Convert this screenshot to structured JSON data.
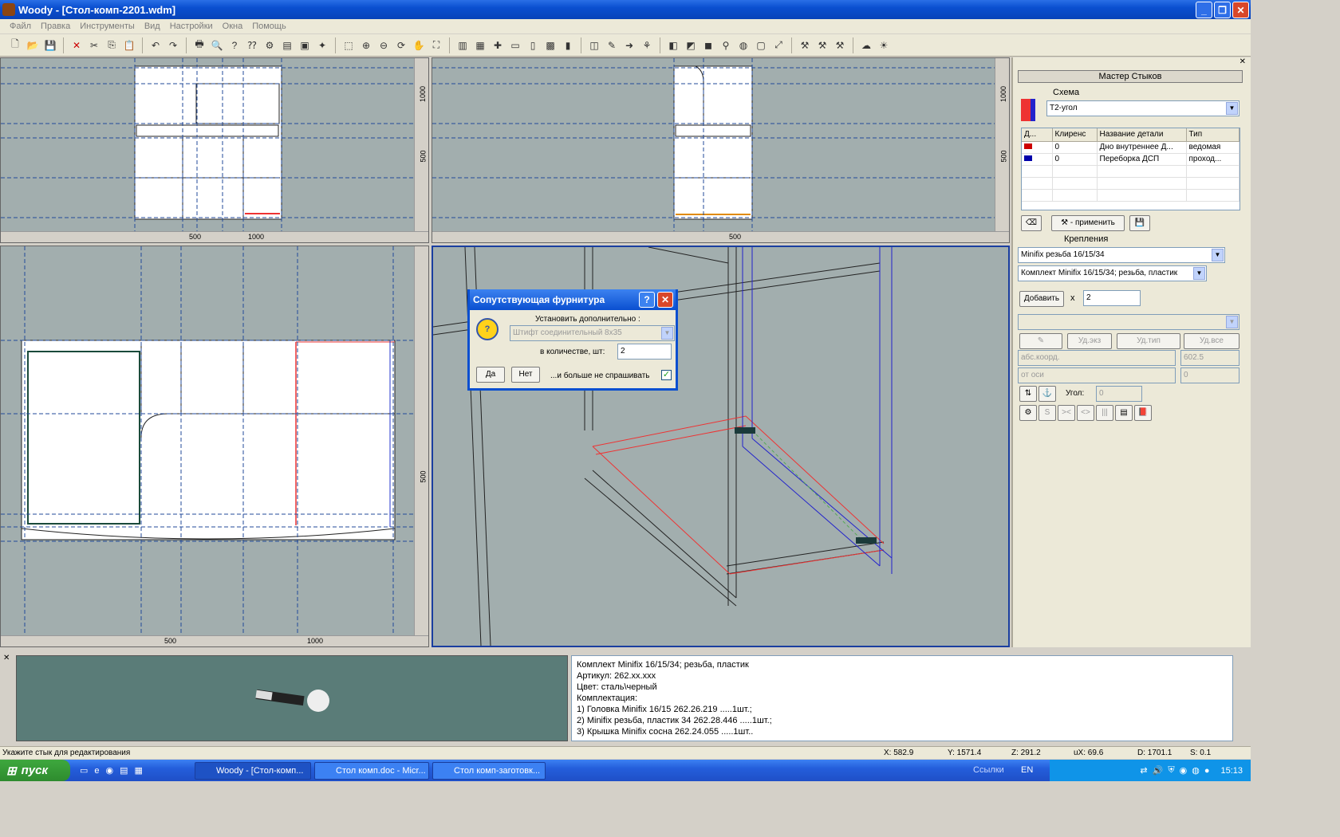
{
  "window": {
    "title": "Woody - [Стол-комп-2201.wdm]"
  },
  "menu": [
    "Файл",
    "Правка",
    "Инструменты",
    "Вид",
    "Настройки",
    "Окна",
    "Помощь"
  ],
  "views": {
    "front": {
      "v1": "1000",
      "v2": "500",
      "h1": "500",
      "h2": "1000"
    },
    "side": {
      "v1": "1000",
      "v2": "500",
      "h1": "500"
    },
    "top": {
      "v1": "500",
      "h1": "500",
      "h2": "1000"
    }
  },
  "dialog": {
    "title": "Сопутствующая фурнитура",
    "install_label": "Установить дополнительно :",
    "item_value": "Штифт соединительный 8х35",
    "qty_label": "в количестве, шт:",
    "qty_value": "2",
    "yes": "Да",
    "no": "Нет",
    "dont_ask": "...и больше не спрашивать"
  },
  "panel": {
    "title": "Мастер Стыков",
    "scheme_label": "Схема",
    "scheme_value": "Т2-угол",
    "table": {
      "headers": [
        "Д...",
        "Клиренс",
        "Название детали",
        "Тип"
      ],
      "rows": [
        {
          "clearance": "0",
          "name": "Дно внутреннее Д...",
          "type": "ведомая",
          "color": "#cc0000"
        },
        {
          "clearance": "0",
          "name": "Переборка ДСП",
          "type": "проход...",
          "color": "#0000aa"
        }
      ]
    },
    "apply_label": "- применить",
    "fasteners_label": "Крепления",
    "fastener_value": "Minifix резьба 16/15/34",
    "kit_value": "Комплект Minifix 16/15/34; резьба, пластик",
    "add_label": "Добавить",
    "times": "x",
    "count": "2",
    "del_inst": "Уд.экз",
    "del_type": "Уд.тип",
    "del_all": "Уд.все",
    "coord_mode": "абс.коорд.",
    "coord_value": "602.5",
    "axis_mode": "от оси",
    "axis_value": "0",
    "angle_label": "Угол:",
    "angle_value": "0"
  },
  "info": {
    "lines": [
      "Комплект Minifix 16/15/34; резьба, пластик",
      "Артикул: 262.xx.xxx",
      "Цвет: сталь\\черный",
      "Комплектация:",
      "1) Головка Minifix 16/15 262.26.219 .....1шт.;",
      "2) Minifix резьба, пластик 34 262.28.446 .....1шт.;",
      "3) Крышка Minifix сосна 262.24.055 .....1шт.."
    ]
  },
  "status": {
    "hint": "Укажите стык для редактирования",
    "x": "X:   582.9",
    "y": "Y:  1571.4",
    "z": "Z:   291.2",
    "ux": "uX:  69.6",
    "d": "D:  1701.1",
    "s": "S:  0.1"
  },
  "taskbar": {
    "start": "пуск",
    "tasks": [
      "Woody - [Стол-комп...",
      "Стол комп.doc - Micr...",
      "Стол комп-заготовк..."
    ],
    "links": "Ссылки",
    "lang": "EN",
    "clock": "15:13"
  }
}
